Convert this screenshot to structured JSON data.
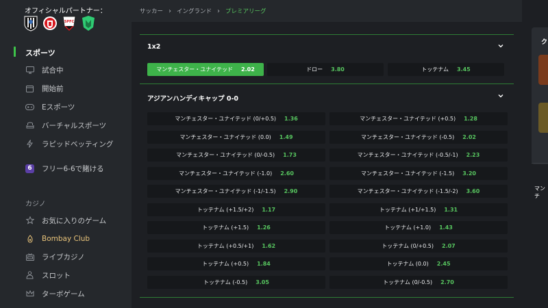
{
  "sidebar": {
    "partners_title": "オフィシャルパートナー：",
    "partners": [
      "newcastle-logo",
      "southampton-logo",
      "sao-paulo-logo",
      "invictus-logo"
    ],
    "sports_title": "スポーツ",
    "sports_items": [
      {
        "icon": "monitor-icon",
        "label": "試合中"
      },
      {
        "icon": "calendar-icon",
        "label": "開始前"
      },
      {
        "icon": "gamepad-icon",
        "label": "Eスポーツ"
      },
      {
        "icon": "couch-icon",
        "label": "バーチャルスポーツ"
      },
      {
        "icon": "lightning-icon",
        "label": "ラピッドベッティング"
      }
    ],
    "free_six": {
      "badge": "6",
      "label": "フリー6-6で賭ける"
    },
    "casino_title": "カジノ",
    "casino_items": [
      {
        "icon": "star-icon",
        "label": "お気に入りのゲーム"
      },
      {
        "icon": "club-icon",
        "label": "Bombay Club"
      },
      {
        "icon": "live-casino-icon",
        "label": "ライブカジノ"
      },
      {
        "icon": "slot-icon",
        "label": "スロット"
      },
      {
        "icon": "crown-icon",
        "label": "ターボゲーム"
      }
    ]
  },
  "breadcrumb": {
    "items": [
      "サッカー",
      "イングランド"
    ],
    "current": "プレミアリーグ"
  },
  "market_1x2": {
    "title": "1x2",
    "options": [
      {
        "label": "マンチェスター・ユナイテッド",
        "odds": "2.02",
        "selected": true
      },
      {
        "label": "ドロー",
        "odds": "3.80",
        "selected": false
      },
      {
        "label": "トッテナム",
        "odds": "3.45",
        "selected": false
      }
    ]
  },
  "market_asian": {
    "title": "アジアンハンディキャップ 0-0",
    "left": [
      {
        "label": "マンチェスター・ユナイテッド (0/+0.5)",
        "odds": "1.36"
      },
      {
        "label": "マンチェスター・ユナイテッド (0.0)",
        "odds": "1.49"
      },
      {
        "label": "マンチェスター・ユナイテッド (0/-0.5)",
        "odds": "1.73"
      },
      {
        "label": "マンチェスター・ユナイテッド (-1.0)",
        "odds": "2.60"
      },
      {
        "label": "マンチェスター・ユナイテッド (-1/-1.5)",
        "odds": "2.90"
      },
      {
        "label": "トッテナム (+1.5/+2)",
        "odds": "1.17"
      },
      {
        "label": "トッテナム (+1.5)",
        "odds": "1.26"
      },
      {
        "label": "トッテナム (+0.5/+1)",
        "odds": "1.62"
      },
      {
        "label": "トッテナム (+0.5)",
        "odds": "1.84"
      },
      {
        "label": "トッテナム (-0.5)",
        "odds": "3.05"
      }
    ],
    "right": [
      {
        "label": "マンチェスター・ユナイテッド (+0.5)",
        "odds": "1.28"
      },
      {
        "label": "マンチェスター・ユナイテッド (-0.5)",
        "odds": "2.02"
      },
      {
        "label": "マンチェスター・ユナイテッド (-0.5/-1)",
        "odds": "2.23"
      },
      {
        "label": "マンチェスター・ユナイテッド (-1.5)",
        "odds": "3.20"
      },
      {
        "label": "マンチェスター・ユナイテッド (-1.5/-2)",
        "odds": "3.60"
      },
      {
        "label": "トッテナム (+1/+1.5)",
        "odds": "1.31"
      },
      {
        "label": "トッテナム (+1.0)",
        "odds": "1.43"
      },
      {
        "label": "トッテナム (0/+0.5)",
        "odds": "2.07"
      },
      {
        "label": "トッテナム (0.0)",
        "odds": "2.45"
      },
      {
        "label": "トッテナム (0/-0.5)",
        "odds": "2.70"
      }
    ]
  },
  "right_panel": {
    "title": "ク",
    "text_line": "マンチ"
  },
  "colors": {
    "accent": "#3eb34a",
    "odds_green": "#57c55f",
    "background": "#1d1f23",
    "panel": "#25282c"
  }
}
